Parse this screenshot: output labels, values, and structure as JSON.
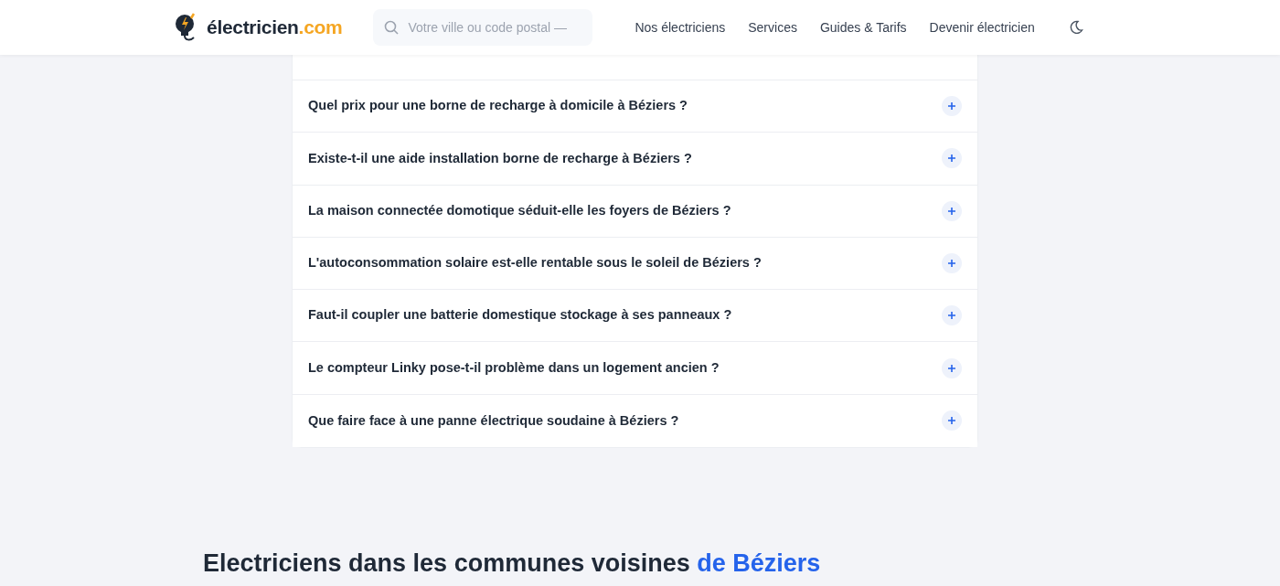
{
  "header": {
    "logo_name": "électricien",
    "logo_suffix": ".com",
    "search": {
      "placeholder": "Votre ville ou code postal —"
    },
    "nav": [
      "Nos électriciens",
      "Services",
      "Guides & Tarifs",
      "Devenir électricien"
    ]
  },
  "faq": [
    {
      "question": "Quel prix pour une borne de recharge à domicile à Béziers ?",
      "expanded": false
    },
    {
      "question": "Existe-t-il une aide installation borne de recharge à Béziers ?",
      "expanded": false
    },
    {
      "question": "La maison connectée domotique séduit-elle les foyers de Béziers ?",
      "expanded": false
    },
    {
      "question": "L'autoconsommation solaire est-elle rentable sous le soleil de Béziers ?",
      "expanded": false
    },
    {
      "question": "Faut-il coupler une batterie domestique stockage à ses panneaux ?",
      "expanded": false
    },
    {
      "question": "Le compteur Linky pose-t-il problème dans un logement ancien ?",
      "expanded": false
    },
    {
      "question": "Que faire face à une panne électrique soudaine à Béziers ?",
      "expanded": false
    }
  ],
  "section": {
    "title": "Electriciens dans les communes voisines",
    "title_highlight": "de Béziers"
  }
}
